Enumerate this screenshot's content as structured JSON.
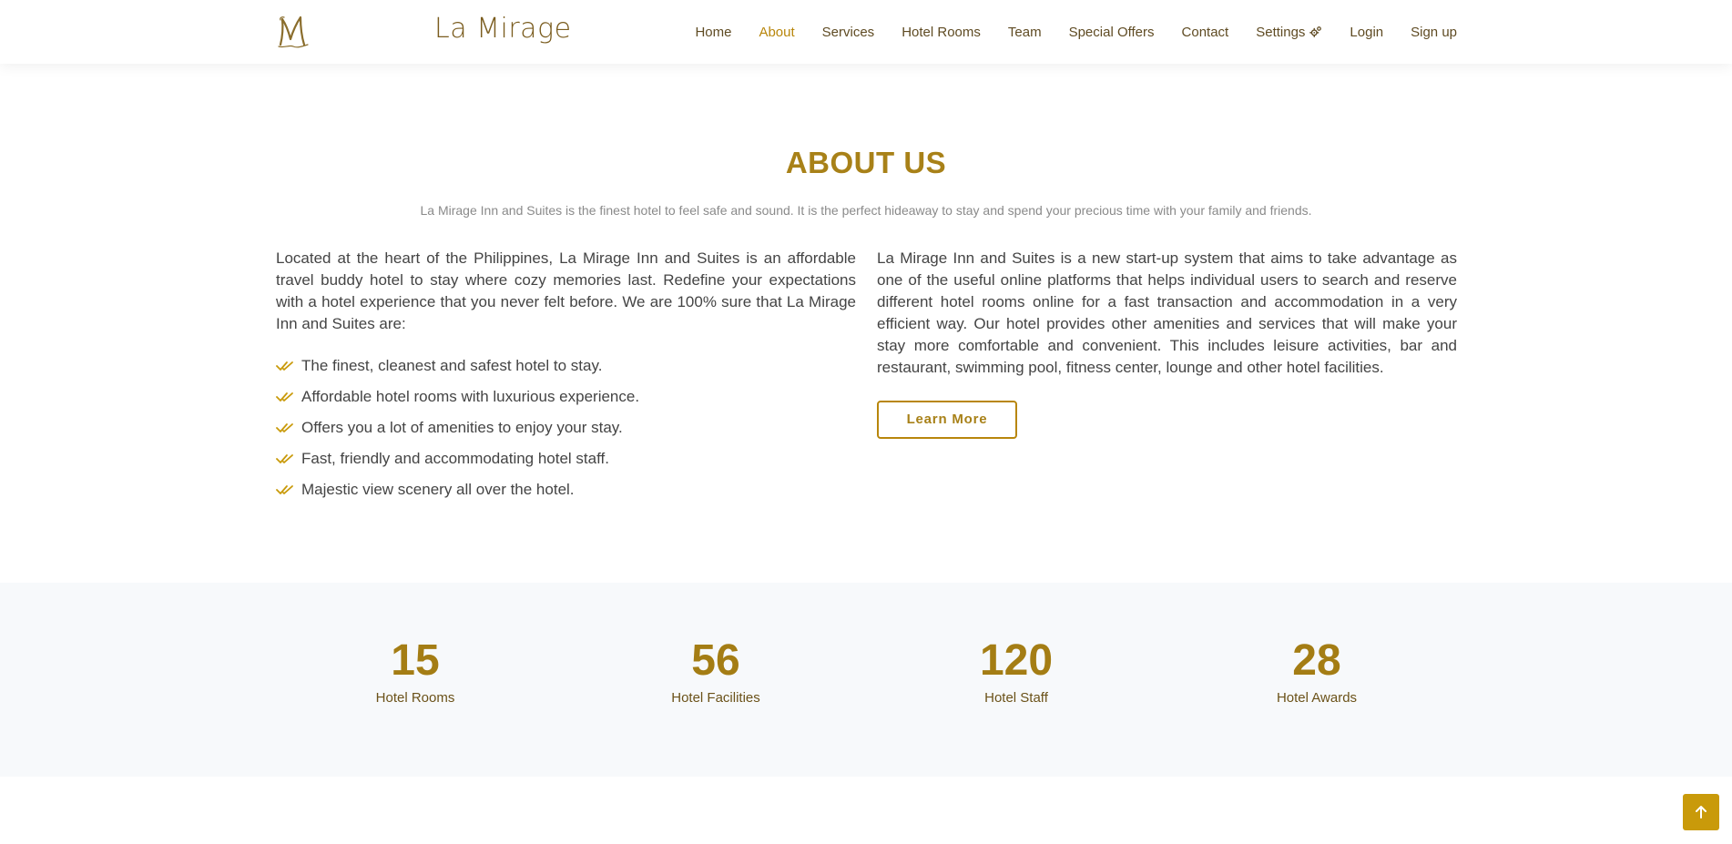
{
  "header": {
    "brand": "La Mirage",
    "logo_icon": "m-monogram-logo-icon",
    "nav": [
      {
        "label": "Home",
        "active": false
      },
      {
        "label": "About",
        "active": true
      },
      {
        "label": "Services",
        "active": false
      },
      {
        "label": "Hotel Rooms",
        "active": false
      },
      {
        "label": "Team",
        "active": false
      },
      {
        "label": "Special Offers",
        "active": false
      },
      {
        "label": "Contact",
        "active": false
      },
      {
        "label": "Settings",
        "active": false,
        "icon": "gears-icon"
      },
      {
        "label": "Login",
        "active": false
      },
      {
        "label": "Sign up",
        "active": false
      }
    ]
  },
  "about": {
    "title": "ABOUT US",
    "subtitle": "La Mirage Inn and Suites is the finest hotel to feel safe and sound. It is the perfect hideaway to stay and spend your precious time with your family and friends.",
    "left_paragraph": "Located at the heart of the Philippines, La Mirage Inn and Suites is an affordable travel buddy hotel to stay where cozy memories last. Redefine your expectations with a hotel experience that you never felt before. We are 100% sure that La Mirage Inn and Suites are:",
    "list": [
      "The finest, cleanest and safest hotel to stay.",
      "Affordable hotel rooms with luxurious experience.",
      "Offers you a lot of amenities to enjoy your stay.",
      "Fast, friendly and accommodating hotel staff.",
      "Majestic view scenery all over the hotel."
    ],
    "list_icon": "double-check-icon",
    "right_paragraph": "La Mirage Inn and Suites is a new start-up system that aims to take advantage as one of the useful online platforms that helps individual users to search and reserve different hotel rooms online for a fast transaction and accommodation in a very efficient way. Our hotel provides other amenities and services that will make your stay more comfortable and convenient. This includes leisure activities, bar and restaurant, swimming pool, fitness center, lounge and other hotel facilities.",
    "button_label": "Learn More"
  },
  "counts": [
    {
      "number": "15",
      "label": "Hotel Rooms"
    },
    {
      "number": "56",
      "label": "Hotel Facilities"
    },
    {
      "number": "120",
      "label": "Hotel Staff"
    },
    {
      "number": "28",
      "label": "Hotel Awards"
    }
  ],
  "back_to_top_icon": "arrow-up-icon",
  "colors": {
    "accent": "#b8860b",
    "title": "#a88118",
    "count_number": "#a47d14",
    "counts_background": "#f7f9fb"
  }
}
